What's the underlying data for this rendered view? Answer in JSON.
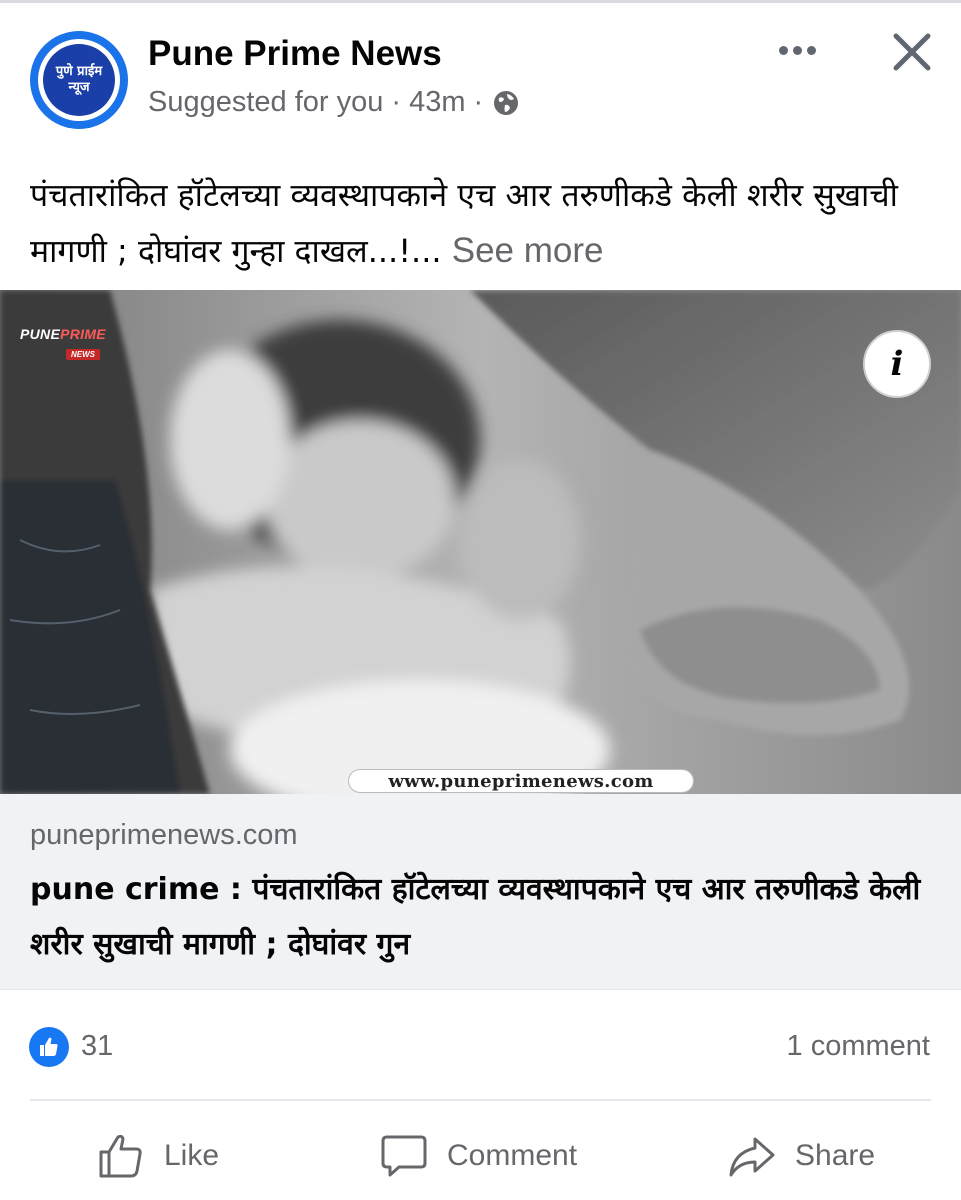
{
  "post": {
    "page_name": "Pune Prime News",
    "avatar_text_line1": "पुणे प्राईम",
    "avatar_text_line2": "न्यूज",
    "suggested": "Suggested for you",
    "separator": "·",
    "time": "43m",
    "text": "पंचतारांकित हॉटेलच्या व्यवस्थापकाने एच आर तरुणीकडे केली शरीर सुखाची मागणी ; दोघांवर गुन्हा दाखल...!...",
    "see_more": "See more"
  },
  "image": {
    "watermark_line1": "PUNE",
    "watermark_line1_accent": "PRIME",
    "watermark_line2": "NEWS",
    "info_label": "i",
    "website": "www.puneprimenews.com"
  },
  "link_preview": {
    "domain": "puneprimenews.com",
    "title": "pune crime : पंचतारांकित हॉटेलच्या व्यवस्थापकाने एच आर तरुणीकडे केली शरीर सुखाची मागणी ; दोघांवर गुन"
  },
  "stats": {
    "likes": "31",
    "comments": "1 comment"
  },
  "actions": {
    "like": "Like",
    "comment": "Comment",
    "share": "Share"
  },
  "icons": {
    "avatar": "pune-prime-news-logo",
    "globe": "globe-icon",
    "more": "more-icon",
    "close": "close-icon",
    "info": "info-icon",
    "like_badge": "thumbs-up-icon",
    "like": "thumbs-up-outline-icon",
    "comment": "speech-bubble-icon",
    "share": "share-arrow-icon"
  },
  "colors": {
    "brand_blue": "#1877f2",
    "secondary_text": "#65676b",
    "primary_text": "#050505",
    "link_bg": "#f0f2f5",
    "avatar_ring": "#1a73e8"
  }
}
